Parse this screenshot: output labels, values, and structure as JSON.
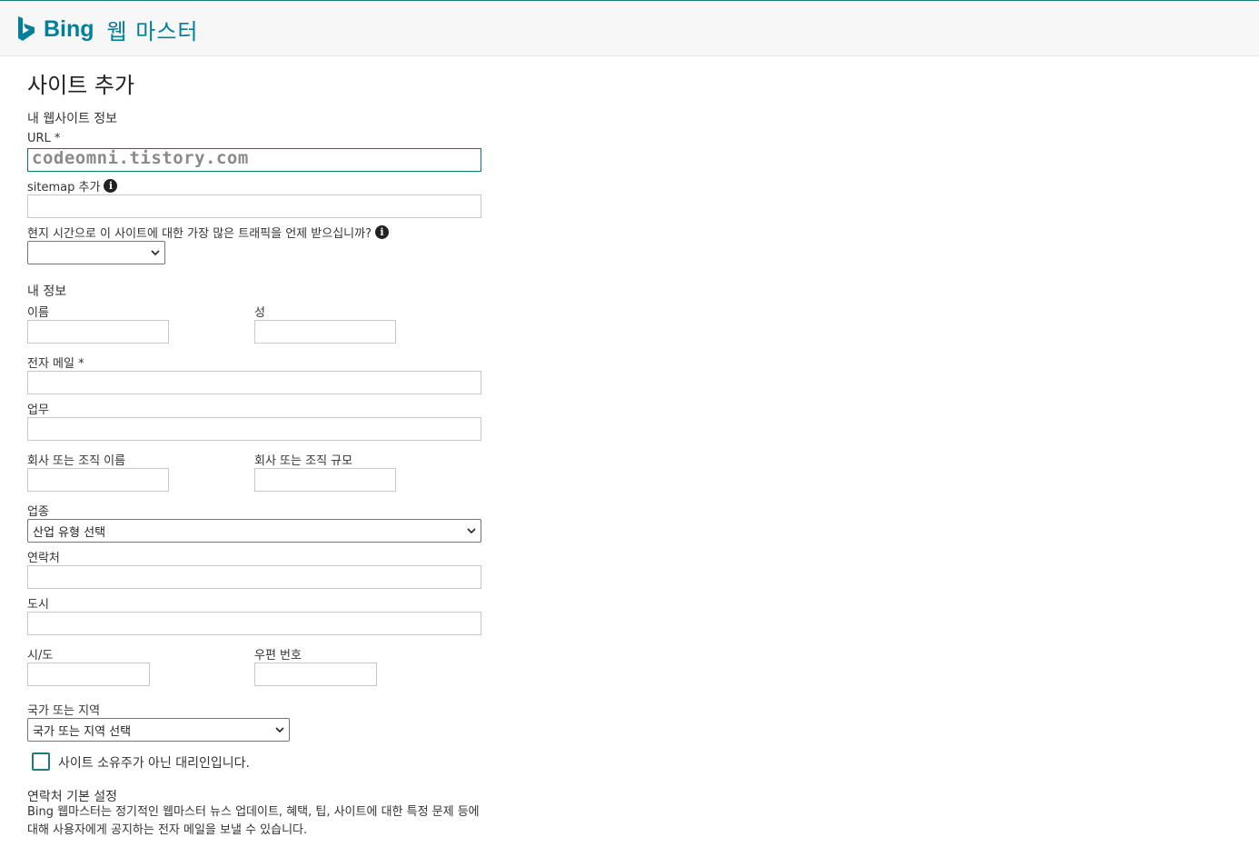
{
  "header": {
    "logo_icon": "bing-logo-icon",
    "brand": "Bing",
    "product": "웹 마스터",
    "accent_color": "#00809d"
  },
  "page_title": "사이트 추가",
  "website_section": {
    "heading": "내 웹사이트 정보",
    "url_label": "URL *",
    "url_value": "codeomni.tistory.com",
    "sitemap_label": "sitemap 추가",
    "sitemap_value": "",
    "traffic_label": "현지 시간으로 이 사이트에 대한 가장 많은 트래픽을 언제 받으십니까?",
    "traffic_selected": ""
  },
  "info_section": {
    "heading": "내 정보",
    "first_name_label": "이름",
    "last_name_label": "성",
    "email_label": "전자 메일 *",
    "job_label": "업무",
    "company_name_label": "회사 또는 조직 이름",
    "company_size_label": "회사 또는 조직 규모",
    "industry_label": "업종",
    "industry_selected": "산업 유형 선택",
    "phone_label": "연락처",
    "city_label": "도시",
    "state_label": "시/도",
    "postal_label": "우편 번호",
    "country_label": "국가 또는 지역",
    "country_selected": "국가 또는 지역 선택",
    "agent_checkbox_label": "사이트 소유주가 아닌 대리인입니다.",
    "agent_checked": false
  },
  "contact_prefs": {
    "heading": "연락처 기본 설정",
    "description": "Bing 웹마스터는 정기적인 웹마스터 뉴스 업데이트, 혜택, 팁, 사이트에 대한 특정 문제 등에 대해 사용자에게 공지하는 전자 메일을 보낼 수 있습니다."
  },
  "icons": {
    "info": "info-icon",
    "dropdown": "chevron-down-icon"
  }
}
